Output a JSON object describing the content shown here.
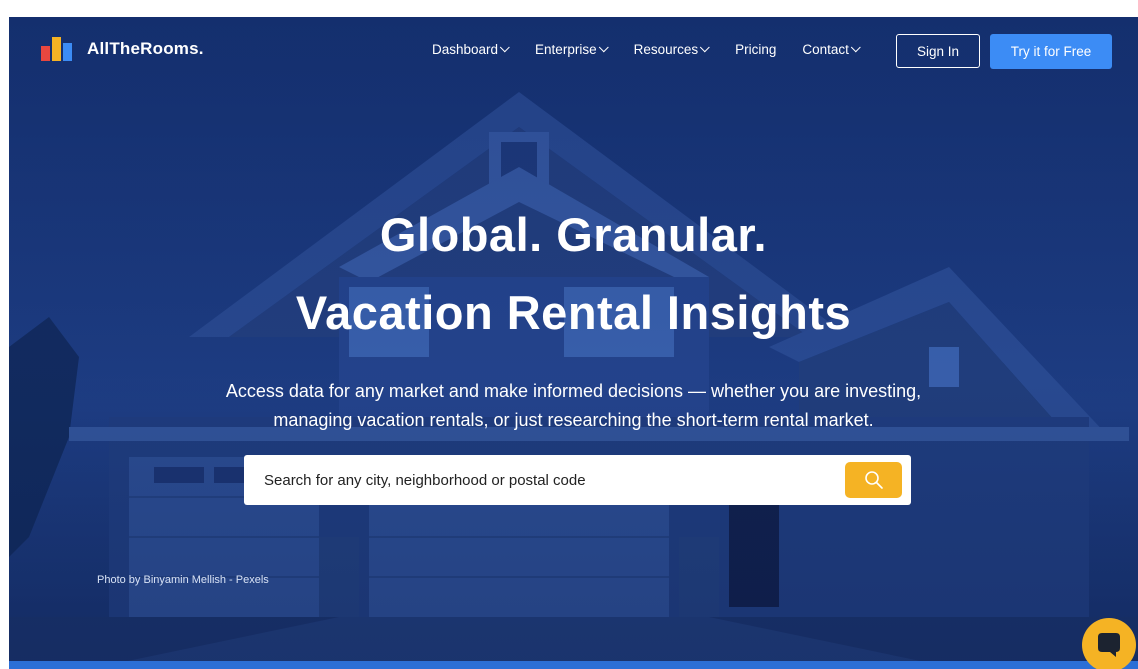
{
  "brand": {
    "name": "AllTheRooms.",
    "colors": {
      "red": "#e8473f",
      "yellow": "#f5b324",
      "blue": "#3c8cf5"
    }
  },
  "nav": {
    "items": [
      {
        "label": "Dashboard",
        "dropdown": true
      },
      {
        "label": "Enterprise",
        "dropdown": true
      },
      {
        "label": "Resources",
        "dropdown": true
      },
      {
        "label": "Pricing",
        "dropdown": false
      },
      {
        "label": "Contact",
        "dropdown": true
      }
    ],
    "signin_label": "Sign In",
    "cta_label": "Try it for Free"
  },
  "hero": {
    "headline_line1": "Global. Granular.",
    "headline_line2": "Vacation Rental Insights",
    "subtitle_line1": "Access data for any market and make informed decisions — whether you are investing,",
    "subtitle_line2": "managing vacation rentals, or just researching the short-term rental market.",
    "search_placeholder": "Search for any city, neighborhood or postal code",
    "photo_credit": "Photo by Binyamin Mellish - Pexels"
  },
  "icons": {
    "search": "search-icon",
    "chat": "chat-icon",
    "chevron": "chevron-down-icon"
  },
  "theme": {
    "hero_tint": "#1a3470",
    "accent_button": "#3c8cf5",
    "search_button": "#f5b324"
  }
}
